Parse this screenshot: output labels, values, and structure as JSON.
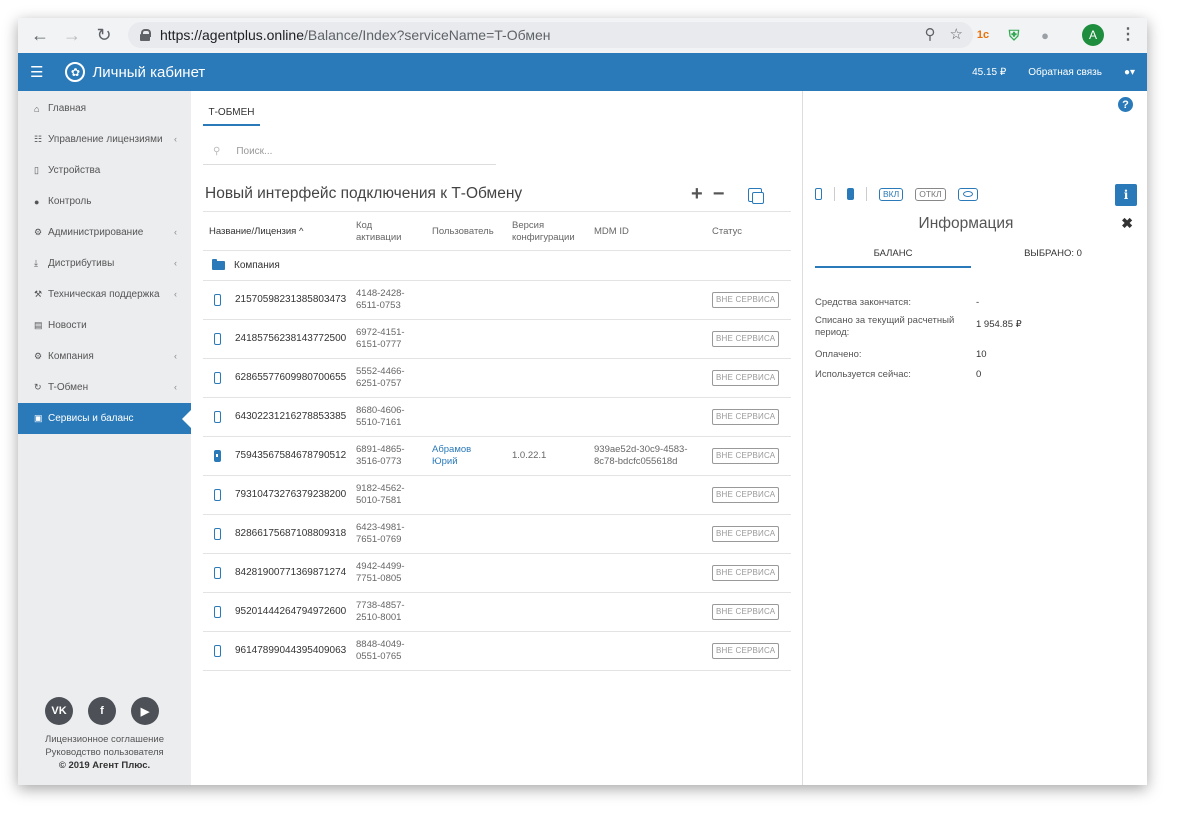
{
  "browser": {
    "url_host": "https://agentplus.online",
    "url_path": "/Balance/Index?serviceName=T-Обмен",
    "avatar_letter": "A"
  },
  "header": {
    "brand": "Личный кабинет",
    "balance": "45.15 ₽",
    "feedback": "Обратная связь"
  },
  "sidebar": {
    "items": [
      {
        "label": "Главная",
        "icon": "home-icon",
        "chevron": false
      },
      {
        "label": "Управление лицензиями",
        "icon": "sitemap-icon",
        "chevron": true
      },
      {
        "label": "Устройства",
        "icon": "mobile-icon",
        "chevron": false
      },
      {
        "label": "Контроль",
        "icon": "globe-icon",
        "chevron": false
      },
      {
        "label": "Администрирование",
        "icon": "gears-icon",
        "chevron": true
      },
      {
        "label": "Дистрибутивы",
        "icon": "download-icon",
        "chevron": true
      },
      {
        "label": "Техническая поддержка",
        "icon": "wrench-icon",
        "chevron": true
      },
      {
        "label": "Новости",
        "icon": "newspaper-icon",
        "chevron": false
      },
      {
        "label": "Компания",
        "icon": "gear-icon",
        "chevron": true
      },
      {
        "label": "T-Обмен",
        "icon": "refresh-icon",
        "chevron": true
      },
      {
        "label": "Сервисы и баланс",
        "icon": "money-icon",
        "chevron": false
      }
    ],
    "footer": {
      "license": "Лицензионное соглашение",
      "guide": "Руководство пользователя",
      "copyright": "© 2019 Агент Плюс."
    }
  },
  "main": {
    "tab": "Т-ОБМЕН",
    "search_placeholder": "Поиск...",
    "title": "Новый интерфейс подключения к Т-Обмену",
    "columns": {
      "name": "Название/Лицензия ^",
      "code": "Код активации",
      "user": "Пользователь",
      "version": "Версия конфигурации",
      "mdm": "MDM ID",
      "status": "Статус"
    },
    "folder": "Компания",
    "rows": [
      {
        "license": "21570598231385803473",
        "code": "4148-2428-6511-0753",
        "user": "",
        "version": "",
        "mdm": "",
        "status": "ВНЕ СЕРВИСА",
        "filled": false
      },
      {
        "license": "24185756238143772500",
        "code": "6972-4151-6151-0777",
        "user": "",
        "version": "",
        "mdm": "",
        "status": "ВНЕ СЕРВИСА",
        "filled": false
      },
      {
        "license": "62865577609980700655",
        "code": "5552-4466-6251-0757",
        "user": "",
        "version": "",
        "mdm": "",
        "status": "ВНЕ СЕРВИСА",
        "filled": false
      },
      {
        "license": "64302231216278853385",
        "code": "8680-4606-5510-7161",
        "user": "",
        "version": "",
        "mdm": "",
        "status": "ВНЕ СЕРВИСА",
        "filled": false
      },
      {
        "license": "75943567584678790512",
        "code": "6891-4865-3516-0773",
        "user": "Абрамов Юрий",
        "version": "1.0.22.1",
        "mdm": "939ae52d-30c9-4583-8c78-bdcfc055618d",
        "status": "ВНЕ СЕРВИСА",
        "filled": true
      },
      {
        "license": "79310473276379238200",
        "code": "9182-4562-5010-7581",
        "user": "",
        "version": "",
        "mdm": "",
        "status": "ВНЕ СЕРВИСА",
        "filled": false
      },
      {
        "license": "82866175687108809318",
        "code": "6423-4981-7651-0769",
        "user": "",
        "version": "",
        "mdm": "",
        "status": "ВНЕ СЕРВИСА",
        "filled": false
      },
      {
        "license": "84281900771369871274",
        "code": "4942-4499-7751-0805",
        "user": "",
        "version": "",
        "mdm": "",
        "status": "ВНЕ СЕРВИСА",
        "filled": false
      },
      {
        "license": "95201444264794972600",
        "code": "7738-4857-2510-8001",
        "user": "",
        "version": "",
        "mdm": "",
        "status": "ВНЕ СЕРВИСА",
        "filled": false
      },
      {
        "license": "96147899044395409063",
        "code": "8848-4049-0551-0765",
        "user": "",
        "version": "",
        "mdm": "",
        "status": "ВНЕ СЕРВИСА",
        "filled": false
      }
    ]
  },
  "panel": {
    "on_label": "ВКЛ",
    "off_label": "ОТКЛ",
    "title": "Информация",
    "tab_balance": "БАЛАНС",
    "tab_selected": "ВЫБРАНО: 0",
    "fields": [
      {
        "key": "Средства закончатся:",
        "value": "-"
      },
      {
        "key": "Списано за текущий расчетный период:",
        "value": "1 954.85 ₽"
      },
      {
        "key": "Оплачено:",
        "value": "10"
      },
      {
        "key": "Используется сейчас:",
        "value": "0"
      }
    ]
  },
  "colors": {
    "accent": "#2a7ab9",
    "sidebar_bg": "#ecedef"
  }
}
